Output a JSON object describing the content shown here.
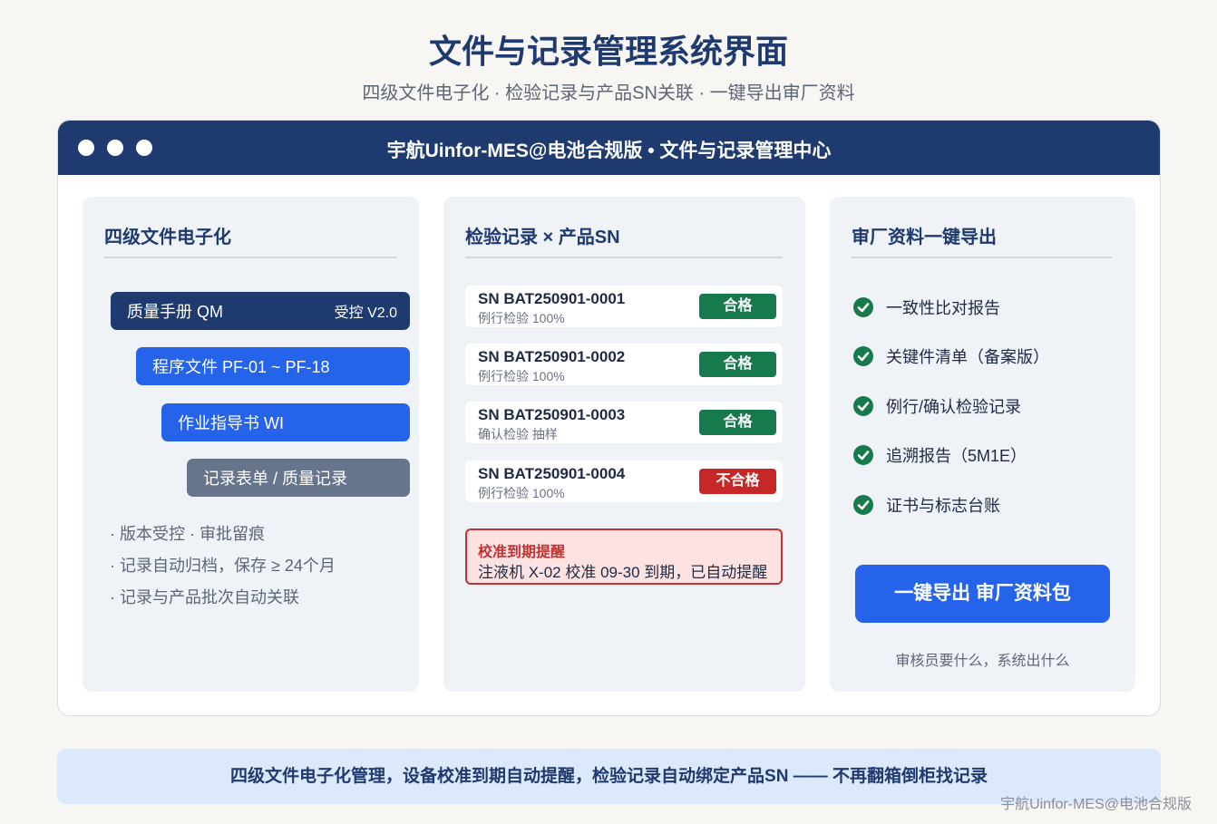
{
  "header": {
    "title": "文件与记录管理系统界面",
    "subtitle": "四级文件电子化 · 检验记录与产品SN关联 · 一键导出审厂资料"
  },
  "window": {
    "title": "宇航Uinfor-MES@电池合规版 • 文件与记录管理中心"
  },
  "docs_panel": {
    "heading": "四级文件电子化",
    "levels": [
      {
        "label": "质量手册 QM",
        "tag": "受控 V2.0",
        "color": "#1e3a6e"
      },
      {
        "label": "程序文件 PF-01 ~ PF-18",
        "tag": "",
        "color": "#2563eb"
      },
      {
        "label": "作业指导书 WI",
        "tag": "",
        "color": "#2563eb"
      },
      {
        "label": "记录表单 / 质量记录",
        "tag": "",
        "color": "#66748c"
      }
    ],
    "notes": [
      "· 版本受控 · 审批留痕",
      "· 记录自动归档，保存 ≥ 24个月",
      "· 记录与产品批次自动关联"
    ]
  },
  "records_panel": {
    "heading": "检验记录 × 产品SN",
    "records": [
      {
        "sn": "SN BAT250901-0001",
        "type": "例行检验 100%",
        "result": "合格",
        "status": "pass"
      },
      {
        "sn": "SN BAT250901-0002",
        "type": "例行检验 100%",
        "result": "合格",
        "status": "pass"
      },
      {
        "sn": "SN BAT250901-0003",
        "type": "确认检验 抽样",
        "result": "合格",
        "status": "pass"
      },
      {
        "sn": "SN BAT250901-0004",
        "type": "例行检验 100%",
        "result": "不合格",
        "status": "fail"
      }
    ],
    "alert": {
      "title": "校准到期提醒",
      "text": "注液机 X-02 校准 09-30 到期，已自动提醒"
    }
  },
  "export_panel": {
    "heading": "审厂资料一键导出",
    "items": [
      "一致性比对报告",
      "关键件清单（备案版）",
      "例行/确认检验记录",
      "追溯报告（5M1E）",
      "证书与标志台账"
    ],
    "button_label": "一键导出 审厂资料包",
    "caption": "审核员要什么，系统出什么"
  },
  "footer": {
    "banner": "四级文件电子化管理，设备校准到期自动提醒，检验记录自动绑定产品SN —— 不再翻箱倒柜找记录",
    "watermark": "宇航Uinfor-MES@电池合规版"
  },
  "colors": {
    "navy": "#1e3a6e",
    "blue": "#2563eb",
    "pass": "#177a4d",
    "fail": "#c62828"
  }
}
